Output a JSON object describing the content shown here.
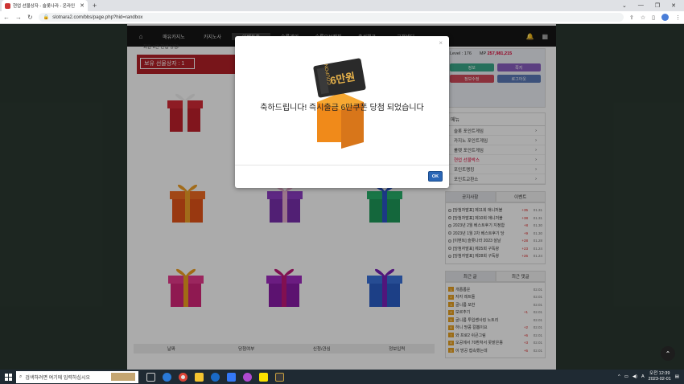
{
  "browser": {
    "tab_title": "현업 선물상자 - 슬롯나라 - 온라인",
    "url": "slotnara2.com/bbs/page.php?hid=randbox"
  },
  "nav": {
    "items": [
      "매유카지노",
      "카지노사",
      "이벤트존",
      "슬롯게임",
      "슬롯유보캠핑",
      "출석체크",
      "고객센터"
    ]
  },
  "content": {
    "notice": "회원 6만 현업 당첨!",
    "box_owner_label": "보유 선물상자 : 1",
    "table_headers": [
      "날짜",
      "당첨여부",
      "신청/관심",
      "정보입력"
    ]
  },
  "gifts": [
    {
      "box": "#c0202c",
      "ribbon": "#f0f0f0",
      "lid": "#d42a36"
    },
    {
      "box": "#e55418",
      "ribbon": "#f1a028",
      "lid": "#f06a22"
    },
    {
      "box": "#7a2fae",
      "ribbon": "#e8b0d0",
      "lid": "#8d3cc4"
    },
    {
      "box": "#1e9a5a",
      "ribbon": "#2a56c6",
      "lid": "#28b06a"
    },
    {
      "box": "#d6267a",
      "ribbon": "#f0a020",
      "lid": "#e83a8c"
    },
    {
      "box": "#8a1ca8",
      "ribbon": "#c0187a",
      "lid": "#a02ac0"
    },
    {
      "box": "#2a5ec8",
      "ribbon": "#7a22b8",
      "lid": "#3a72dc"
    }
  ],
  "sidebar": {
    "level_label": "Level : 176",
    "mp_label": "MP",
    "mp_value": "257,981,215",
    "buttons": [
      {
        "label": "정보",
        "color": "#3aa88a"
      },
      {
        "label": "쪽지",
        "color": "#8a5ec0"
      },
      {
        "label": "정보수정",
        "color": "#d04a5a"
      },
      {
        "label": "로그아웃",
        "color": "#5a7ab8"
      }
    ],
    "menu_title": "메뉴",
    "menu": [
      "슬롯 포인트게임",
      "카지노 포인트게임",
      "룰렛 포인트게임",
      "현업 선물박스",
      "포인트랭킹",
      "포인트교환소"
    ],
    "menu_active": "현업 선물박스",
    "tabs1": [
      "공지사항",
      "이벤트"
    ],
    "notices": [
      {
        "t": "[당첨자발표] 제11회 애니저블",
        "c": "+35",
        "d": "01.31"
      },
      {
        "t": "[당첨자발표] 제10회 애니저블",
        "c": "+38",
        "d": "01.31"
      },
      {
        "t": "2023년 2월 베스트후기 지정합",
        "c": "+8",
        "d": "01.30"
      },
      {
        "t": "2023년 1월 2차 베스트후기 당",
        "c": "+9",
        "d": "01.30"
      },
      {
        "t": "[이벤트] 슬롯나라 2023 설날",
        "c": "+28",
        "d": "01.28"
      },
      {
        "t": "[당첨자발표] 제25회 구독왕",
        "c": "+23",
        "d": "01.24"
      },
      {
        "t": "[당첨자발표] 제28회 구독왕",
        "c": "+26",
        "d": "01.24"
      }
    ],
    "tabs2": [
      "최근 글",
      "최근 댓글"
    ],
    "recent": [
      {
        "n": "1",
        "t": "개롭롭운",
        "c": "",
        "d": "02.01"
      },
      {
        "n": "2",
        "t": "자자 레트돌",
        "c": "",
        "d": "02.01"
      },
      {
        "n": "3",
        "t": "골니름 포한",
        "c": "",
        "d": "02.01"
      },
      {
        "n": "4",
        "t": "모르추기",
        "c": "+1",
        "d": "02.01"
      },
      {
        "n": "5",
        "t": "골니름 투입쌩사킹 노트리",
        "c": "",
        "d": "02.01"
      },
      {
        "n": "6",
        "t": "하니 땅콩 칼뽑이요",
        "c": "+2",
        "d": "02.01"
      },
      {
        "n": "7",
        "t": "와 프로2 쉬큰그림",
        "c": "+6",
        "d": "02.01"
      },
      {
        "n": "8",
        "t": "오공에서 70환처서 못밭은똥",
        "c": "+3",
        "d": "02.01"
      },
      {
        "n": "9",
        "t": "이 방공 접속했는데",
        "c": "+6",
        "d": "02.01"
      }
    ]
  },
  "modal": {
    "coupon_text": "COUPON",
    "coupon_amount": "6만원",
    "message": "축하드립니다! 즉시출금 6만쿠폰 당첨 되었습니다",
    "ok": "OK"
  },
  "taskbar": {
    "search_placeholder": "검색하려면 여기에 입력하십시오",
    "time": "오전 12:39",
    "date": "2023-02-01"
  }
}
